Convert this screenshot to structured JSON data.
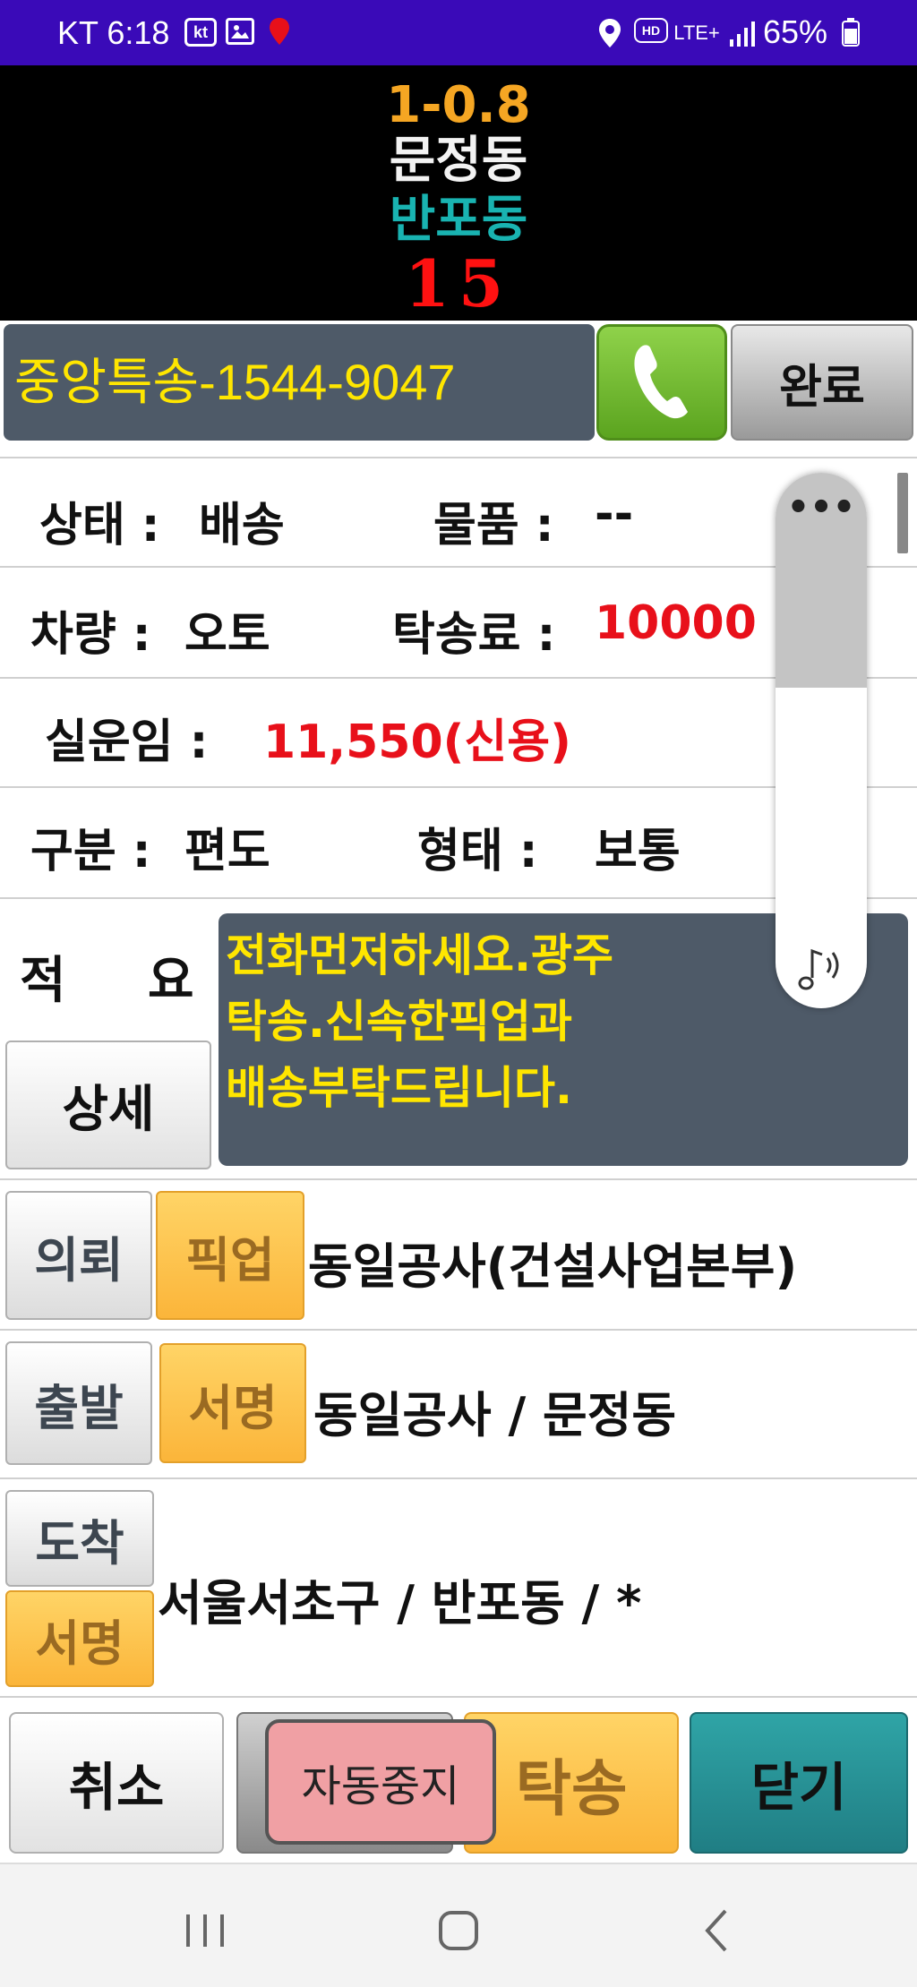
{
  "status_bar": {
    "carrier_time": "KT 6:18",
    "kt_badge": "kt",
    "hd_badge": "HD",
    "network": "LTE+",
    "battery": "65%"
  },
  "header": {
    "distance": "1-0.8",
    "origin": "문정동",
    "destination": "반포동",
    "count": "15"
  },
  "company": {
    "name_phone": "중앙특송-1544-9047",
    "done_label": "완료"
  },
  "info": {
    "status_label": "상태 :",
    "status_value": "배송",
    "item_label": "물품 :",
    "item_value": "--",
    "vehicle_label": "차량 :",
    "vehicle_value": "오토",
    "fee_label": "탁송료 :",
    "fee_value": "10000",
    "actual_label": "실운임 :",
    "actual_value": "11,550(신용)",
    "type_label": "구분 :",
    "type_value": "편도",
    "form_label": "형태 :",
    "form_value": "보통"
  },
  "memo": {
    "label_a": "적",
    "label_b": "요",
    "detail_button": "상세",
    "lines": [
      "전화먼저하세요.광주",
      "탁송.신속한픽업과",
      "배송부탁드립니다."
    ]
  },
  "volume": {
    "menu": "•••"
  },
  "steps": {
    "request_label": "의뢰",
    "pickup_label": "픽업",
    "request_text": "동일공사(건설사업본부)",
    "depart_label": "출발",
    "sign1_label": "서명",
    "depart_text": "동일공사 / 문정동",
    "arrive_label": "도착",
    "sign2_label": "서명",
    "arrive_text": "서울서초구 / 반포동 / *"
  },
  "bottom": {
    "cancel": "취소",
    "autostop": "자동중지",
    "deliver": "탁송",
    "close": "닫기"
  }
}
